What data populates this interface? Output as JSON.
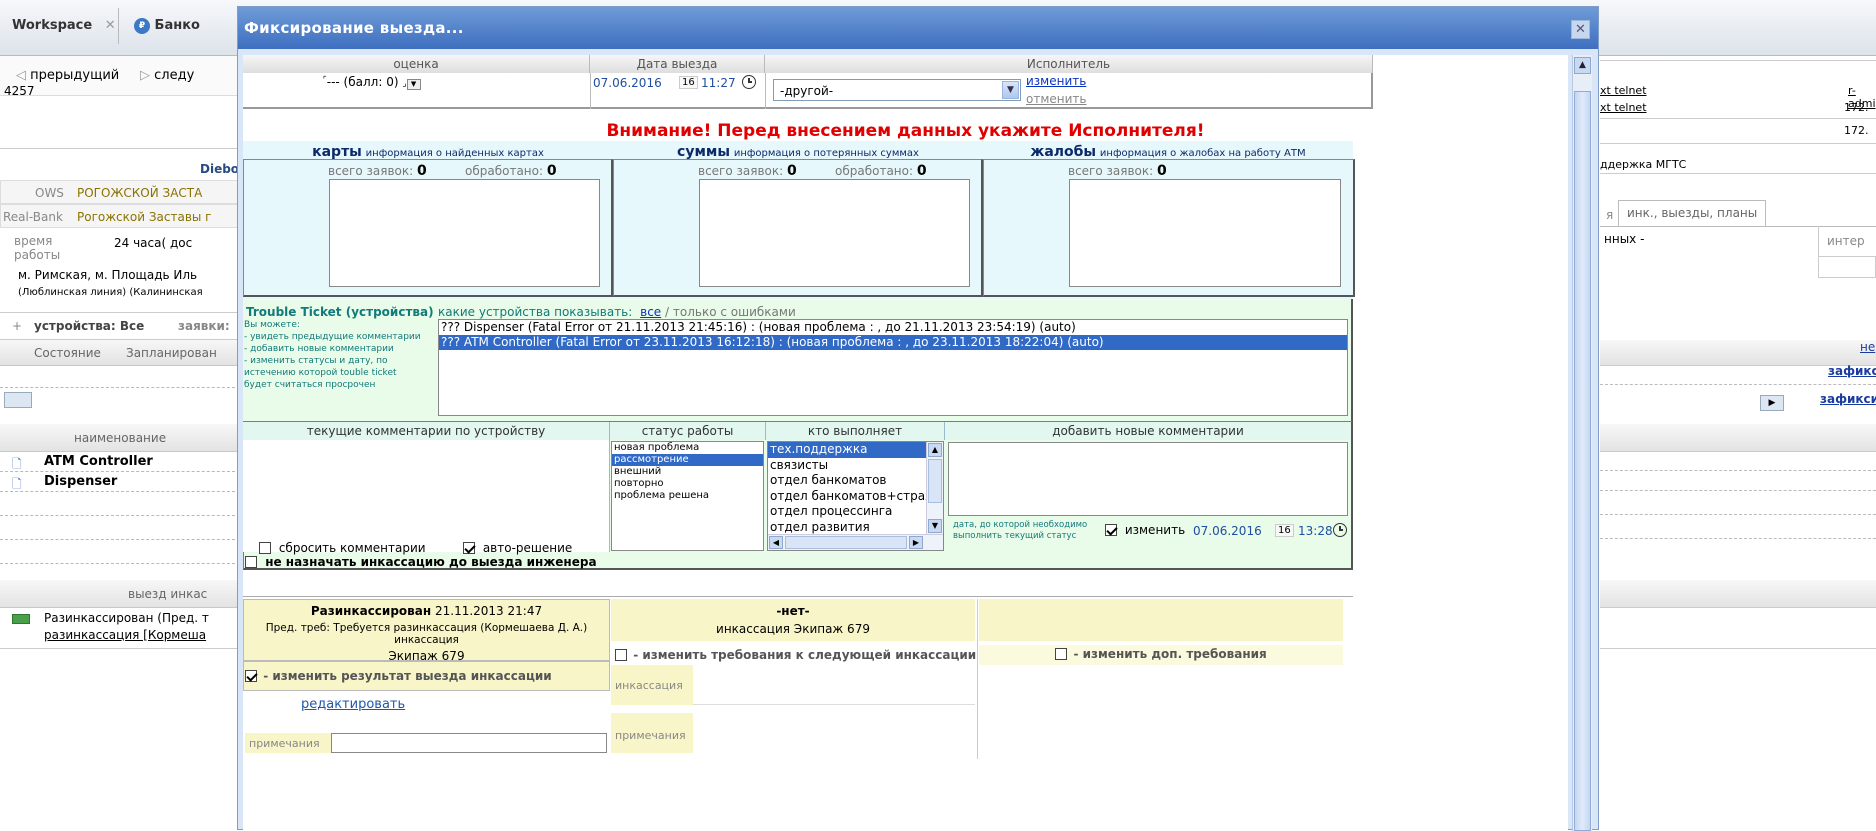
{
  "tabs": {
    "workspace": "Workspace",
    "bank": "Банко"
  },
  "nav": {
    "prev": "прерыдущий",
    "next": "следу"
  },
  "left": {
    "id": "4257",
    "brand": "Diebo",
    "ows_label": "OWS",
    "ows_value": "РОГОЖСКОЙ ЗАСТА",
    "real_label": "Real-Bank",
    "real_value": "Рогожской Заставы г",
    "time_label": "время\nработы",
    "time_value": "24 часа( дос",
    "addr1": "м. Римская, м. Площадь Иль",
    "addr2": "(Люблинская линия) (Калининская",
    "dev_tab": "устройства: Все",
    "req_tab": "заявки:",
    "col_state": "Состояние",
    "col_planned": "Запланирован",
    "name_hdr": "наименование",
    "device1": "ATM Controller",
    "device2": "Dispenser",
    "enc_hdr": "выезд инкас",
    "enc_item1": "Разинкассирован (Пред. т",
    "enc_item2": "разинкассация [Кормеша"
  },
  "right": {
    "telnet1": "xt telnet",
    "telnet2": "xt telnet",
    "admin": "r-admi",
    "ip1": "172.",
    "ip2": "172.",
    "support": "ддержка МГТС",
    "tab_label": "инк., выезды, планы",
    "tab_prefix": "я",
    "nnyh": "нных -",
    "inter": "интер",
    "ne": "не",
    "fix1": "зафикс",
    "fix2": "зафикси"
  },
  "modal": {
    "title": "Фиксирование выезда...",
    "close": "✕",
    "col_rating": "оценка",
    "col_date": "Дата выезда",
    "col_executor": "Исполнитель",
    "rating_value": "--- (балл: 0)",
    "date_value": "07.06.2016",
    "date_day": "16",
    "time_value": "11:27",
    "executor_value": "-другой-",
    "link_change": "изменить",
    "link_cancel": "отменить",
    "warning": "Внимание! Перед внесением данных укажите Исполнителя!",
    "cards_title": "карты",
    "cards_sub": "информация о найденных картах",
    "sums_title": "суммы",
    "sums_sub": "информация о потерянных суммах",
    "compl_title": "жалобы",
    "compl_sub": "информация о жалобах на работу АТМ",
    "total_label": "всего заявок:",
    "processed_label": "обработано:",
    "cards_total": "0",
    "cards_processed": "0",
    "sums_total": "0",
    "sums_processed": "0",
    "compl_total": "0",
    "tt_title": "Trouble Ticket (устройства)",
    "tt_help": [
      "Вы можете:",
      "- увидеть предыдущие комментарии",
      "- добавить новые комментарии",
      "- изменить статусы и дату, по",
      "истечению которой touble ticket",
      "будет считаться просрочен"
    ],
    "show_label": "какие устройства показывать:",
    "show_all": "все",
    "show_err": "/ только с ошибками",
    "tickets": [
      "??? Dispenser (Fatal Error от 21.11.2013 21:45:16) : (новая проблема : , до 21.11.2013 23:54:19) (auto)",
      "??? ATM Controller (Fatal Error от 23.11.2013 16:12:18) : (новая проблема : , до 23.11.2013 18:22:04) (auto)"
    ],
    "cur_comments": "текущие комментарии по устройству",
    "status_hdr": "статус работы",
    "who_hdr": "кто выполняет",
    "add_hdr": "добавить новые комментарии",
    "statuses": [
      "новая проблема",
      "рассмотрение",
      "внешний",
      "повторно",
      "проблема решена"
    ],
    "executors": [
      "тех.поддержка",
      "связисты",
      "отдел банкоматов",
      "отдел банкоматов+страхо",
      "отдел процессинга",
      "отдел развития"
    ],
    "reset_comments": "сбросить комментарии",
    "auto_solve": "авто-решение",
    "due_label1": "дата, до которой необходимо",
    "due_label2": "выполнить текущий статус",
    "due_change": "изменить",
    "due_date": "07.06.2016",
    "due_day": "16",
    "due_time": "13:28",
    "no_enc": "не назначать инкассацию до выезда инженера",
    "enc_status": "Разинкассирован",
    "enc_date": "21.11.2013 21:47",
    "enc_desc1": "Пред. треб: Требуется разинкассация (Кормешаева Д. А.) инкассация",
    "enc_desc2": "Экипаж 679",
    "enc_change": "- изменить результат выезда инкассации",
    "enc_edit": "редактировать",
    "enc_notes": "примечания",
    "next_none": "-нет-",
    "next_crew": "инкассация Экипаж 679",
    "next_change": "- изменить требования к следующей инкассации",
    "next_enc": "инкассация",
    "next_notes": "примечания",
    "extra_change": "- изменить доп. требования"
  },
  "colors": {
    "title_bar": "#4a7bc8",
    "warning": "#e00000",
    "selection": "#3169c6",
    "cyan": "#e6f8fb",
    "green": "#e9fbe9",
    "yellow": "#f8f5c9"
  }
}
